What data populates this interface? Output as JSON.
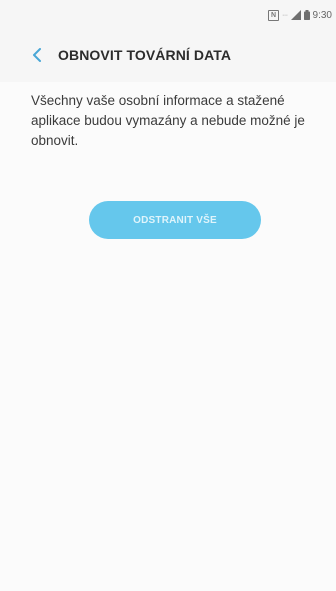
{
  "status_bar": {
    "nfc_label": "N",
    "wifi_label": "···",
    "time": "9:30"
  },
  "header": {
    "title": "OBNOVIT TOVÁRNÍ DATA"
  },
  "main": {
    "description": "Všechny vaše osobní informace a stažené aplikace budou vymazány a nebude možné je obnovit.",
    "reset_button_label": "ODSTRANIT VŠE"
  },
  "colors": {
    "accent": "#65c7ec",
    "back_arrow": "#4aa7d6"
  }
}
